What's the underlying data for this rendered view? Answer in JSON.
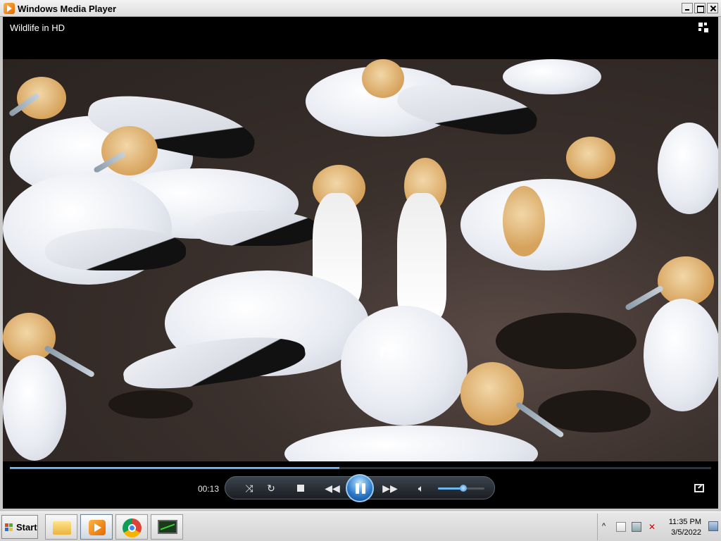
{
  "window": {
    "title": "Windows Media Player"
  },
  "now_playing": {
    "title": "Wildlife in HD"
  },
  "playback": {
    "elapsed": "00:13",
    "progress": 0.47,
    "volume": 0.55,
    "state": "playing"
  },
  "controls": {
    "shuffle_icon": "shuffle-icon",
    "repeat_icon": "repeat-icon",
    "stop_icon": "stop-icon",
    "previous_icon": "previous-icon",
    "play_pause_icon": "pause-icon",
    "next_icon": "next-icon",
    "mute_icon": "speaker-icon"
  },
  "taskbar": {
    "start_label": "Start",
    "apps": [
      "file-explorer-icon",
      "windows-media-player-icon",
      "chrome-icon",
      "task-manager-icon"
    ],
    "clock_time": "11:35 PM",
    "clock_date": "3/5/2022"
  },
  "colors": {
    "seek_fill": "#3a8fd8",
    "accent": "#2f7fcf"
  }
}
